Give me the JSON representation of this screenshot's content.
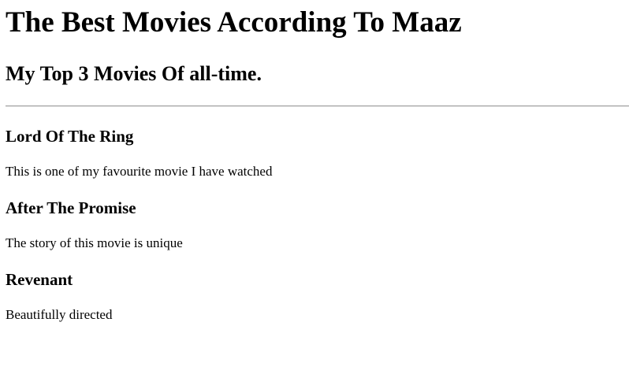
{
  "page": {
    "heading": "The Best Movies According To Maaz",
    "subheading": "My Top 3 Movies Of all-time."
  },
  "movies": [
    {
      "title": "Lord Of The Ring",
      "description": "This is one of my favourite movie I have watched"
    },
    {
      "title": "After The Promise",
      "description": "The story of this movie is unique"
    },
    {
      "title": "Revenant",
      "description": "Beautifully directed"
    }
  ]
}
